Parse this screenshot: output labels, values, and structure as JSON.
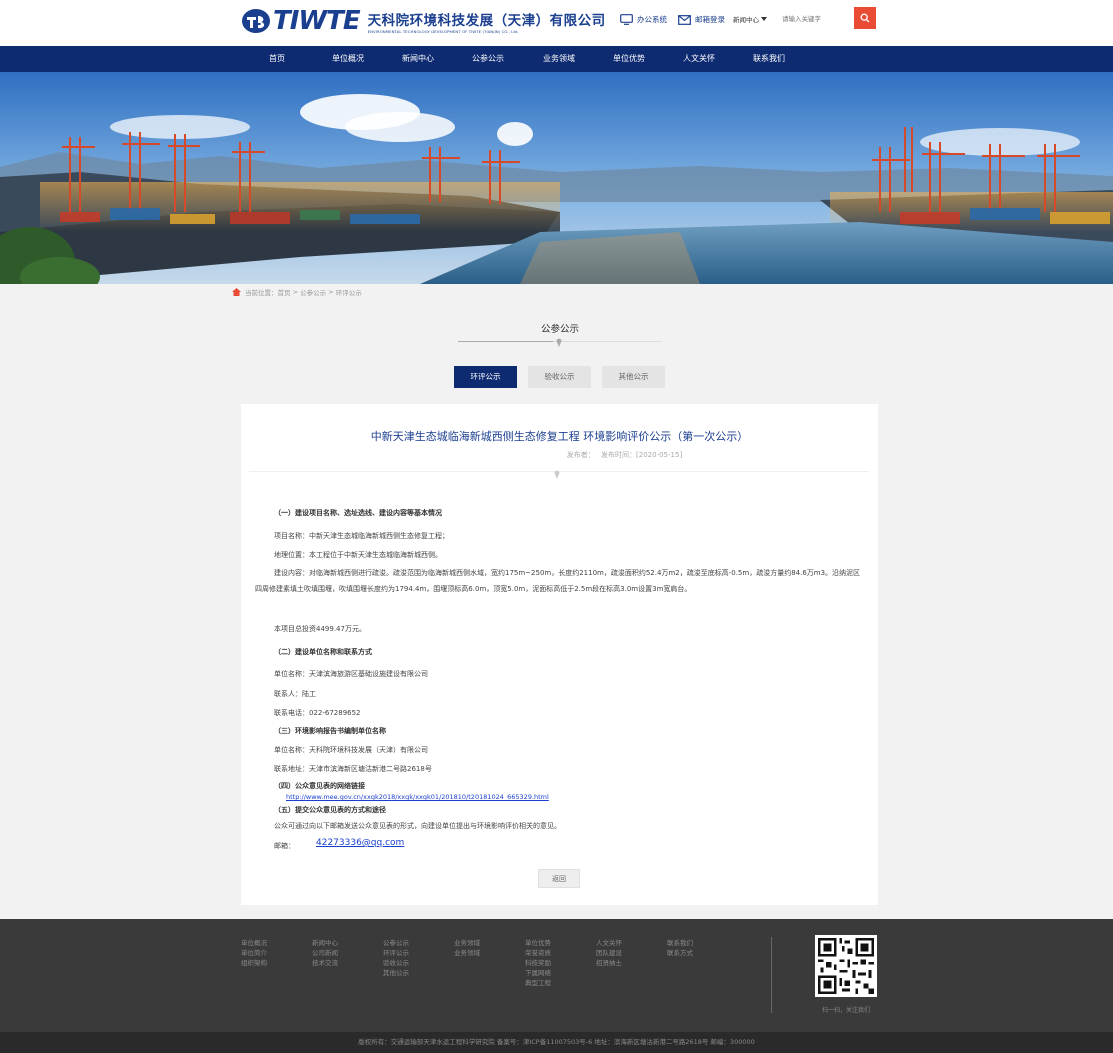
{
  "header": {
    "logo_text": "TIWTE",
    "company_cn": "天科院环境科技发展（天津）有限公司",
    "company_en": "ENVIRONMENTAL TECHNOLOGY DEVELOPMENT OF TIWTE (TIANJIN) CO., Ltd.",
    "office_link": "办公系统",
    "mail_link": "邮箱登录",
    "search_scope": "新闻中心",
    "search_placeholder": "请输入关键字"
  },
  "nav": {
    "items": [
      "首页",
      "单位概况",
      "新闻中心",
      "公参公示",
      "业务领域",
      "单位优势",
      "人文关怀",
      "联系我们"
    ]
  },
  "breadcrumb": {
    "label": "当前位置：",
    "home": "首页",
    "sep1": " > ",
    "level1": "公参公示",
    "sep2": " > ",
    "level2": "环评公示"
  },
  "section": {
    "title": "公参公示",
    "tabs": [
      "环评公示",
      "验收公示",
      "其他公示"
    ],
    "active_tab": "环评公示"
  },
  "article": {
    "title": "中新天津生态城临海新城西侧生态修复工程 环境影响评价公示（第一次公示）",
    "meta_publisher": "发布者：",
    "meta_time": "发布时间：[2020-05-15]",
    "s1_heading": "（一）建设项目名称、选址选线、建设内容等基本情况",
    "s1_name": "项目名称：中新天津生态城临海新城西侧生态修复工程；",
    "s1_location": "地理位置：本工程位于中新天津生态城临海新城西侧。",
    "s1_content": "建设内容：对临海新城西侧进行疏浚。疏浚范围为临海新城西侧水域，宽约175m~250m，长度约2110m，疏浚面积约52.4万m2，疏浚至底标高-0.5m，疏浚方量约84.6万m3。沿纳泥区四周修建素填土吹填围堰，吹填围堰长度约为1794.4m，围堰顶标高6.0m，顶宽5.0m，泥面标高低于2.5m段在标高3.0m设置3m宽肩台。",
    "s1_invest": "本项目总投资4499.47万元。",
    "s2_heading": "（二）建设单位名称和联系方式",
    "s2_unit": "单位名称：天津滨海旅游区基础设施建设有限公司",
    "s2_contact": "联系人：陆工",
    "s2_phone": "联系电话：022-67289652",
    "s3_heading": "（三）环境影响报告书编制单位名称",
    "s3_unit": "单位名称：天科院环境科技发展（天津）有限公司",
    "s3_addr": "联系地址：天津市滨海新区塘沽新港二号路2618号",
    "s4_heading": "（四）公众意见表的网络链接",
    "s4_link": "http://www.mee.gov.cn/xxgk2018/xxgk/xxgk01/201810/t20181024_665329.html",
    "s5_heading": "（五）提交公众意见表的方式和途径",
    "s5_text": "公众可通过向以下邮箱发送公众意见表的形式，向建设单位提出与环境影响评价相关的意见。",
    "s5_mail_label": "邮箱：",
    "s5_mail": "42273336@qq.com",
    "back": "返回"
  },
  "footer": {
    "columns": [
      [
        "单位概况",
        "单位简介",
        "组织架构"
      ],
      [
        "新闻中心",
        "公司新闻",
        "技术交流"
      ],
      [
        "公参公示",
        "环评公示",
        "验收公示",
        "其他公示"
      ],
      [
        "业务领域",
        "业务领域"
      ],
      [
        "单位优势",
        "荣誉资质",
        "科技奖励",
        "下属网络",
        "典型工程"
      ],
      [
        "人文关怀",
        "团队建设",
        "招贤纳士"
      ],
      [
        "联系我们",
        "联系方式"
      ]
    ],
    "qr_caption": "扫一扫，关注我们",
    "copyright": "版权所有：交通运输部天津水运工程科学研究院 备案号：津ICP备11007503号-6 地址：滨海新区塘沽新港二号路2618号 邮编：300000"
  },
  "colors": {
    "nav_bg": "#0e2b72",
    "brand_blue": "#1b3f8f",
    "search_button": "#e94b35",
    "link": "#1a3fd0",
    "footer_bg": "#3a3a3a"
  }
}
